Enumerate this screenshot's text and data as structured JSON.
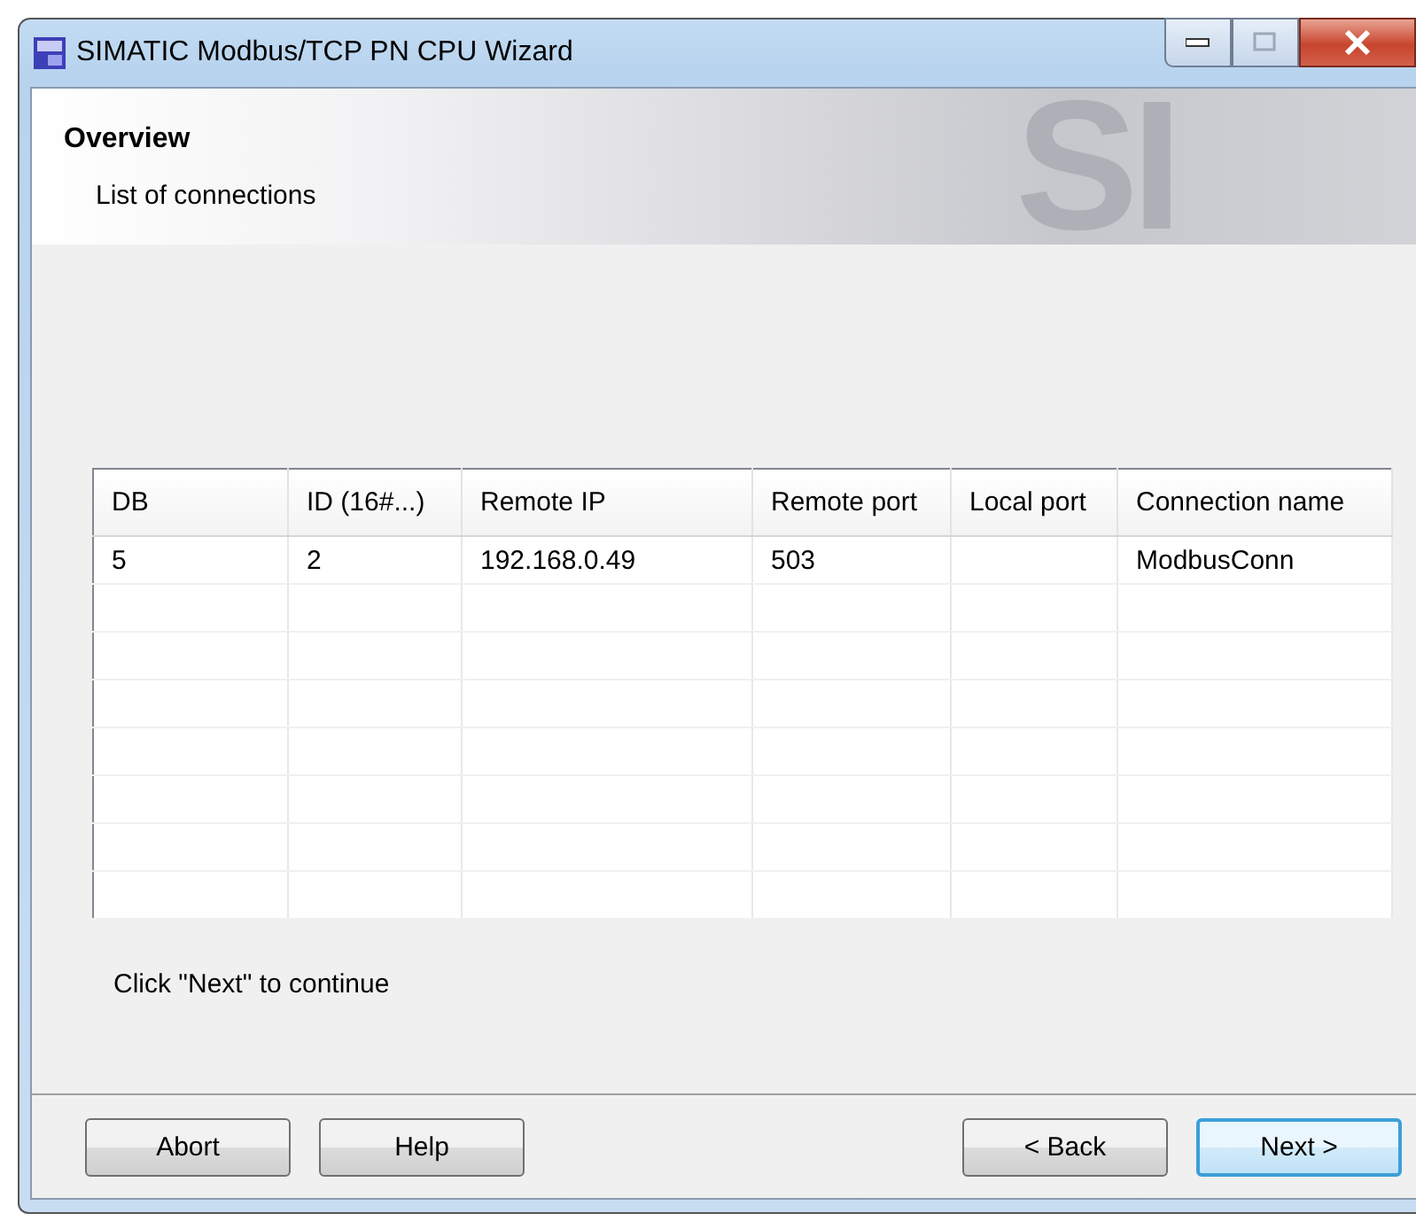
{
  "window": {
    "title": "SIMATIC Modbus/TCP PN CPU Wizard"
  },
  "header": {
    "title": "Overview",
    "subtitle": "List of connections",
    "backdrop_text": "SI"
  },
  "table": {
    "columns": [
      "DB",
      "ID (16#...)",
      "Remote IP",
      "Remote port",
      "Local port",
      "Connection name"
    ],
    "rows": [
      [
        "5",
        "2",
        "192.168.0.49",
        "503",
        "",
        "ModbusConn"
      ]
    ]
  },
  "hint": "Click \"Next\" to continue",
  "buttons": [
    {
      "label": "Abort",
      "kind": "left"
    },
    {
      "label": "Help",
      "kind": "left"
    },
    {
      "label": "< Back",
      "kind": "right"
    },
    {
      "label": "Next >",
      "kind": "default"
    }
  ]
}
